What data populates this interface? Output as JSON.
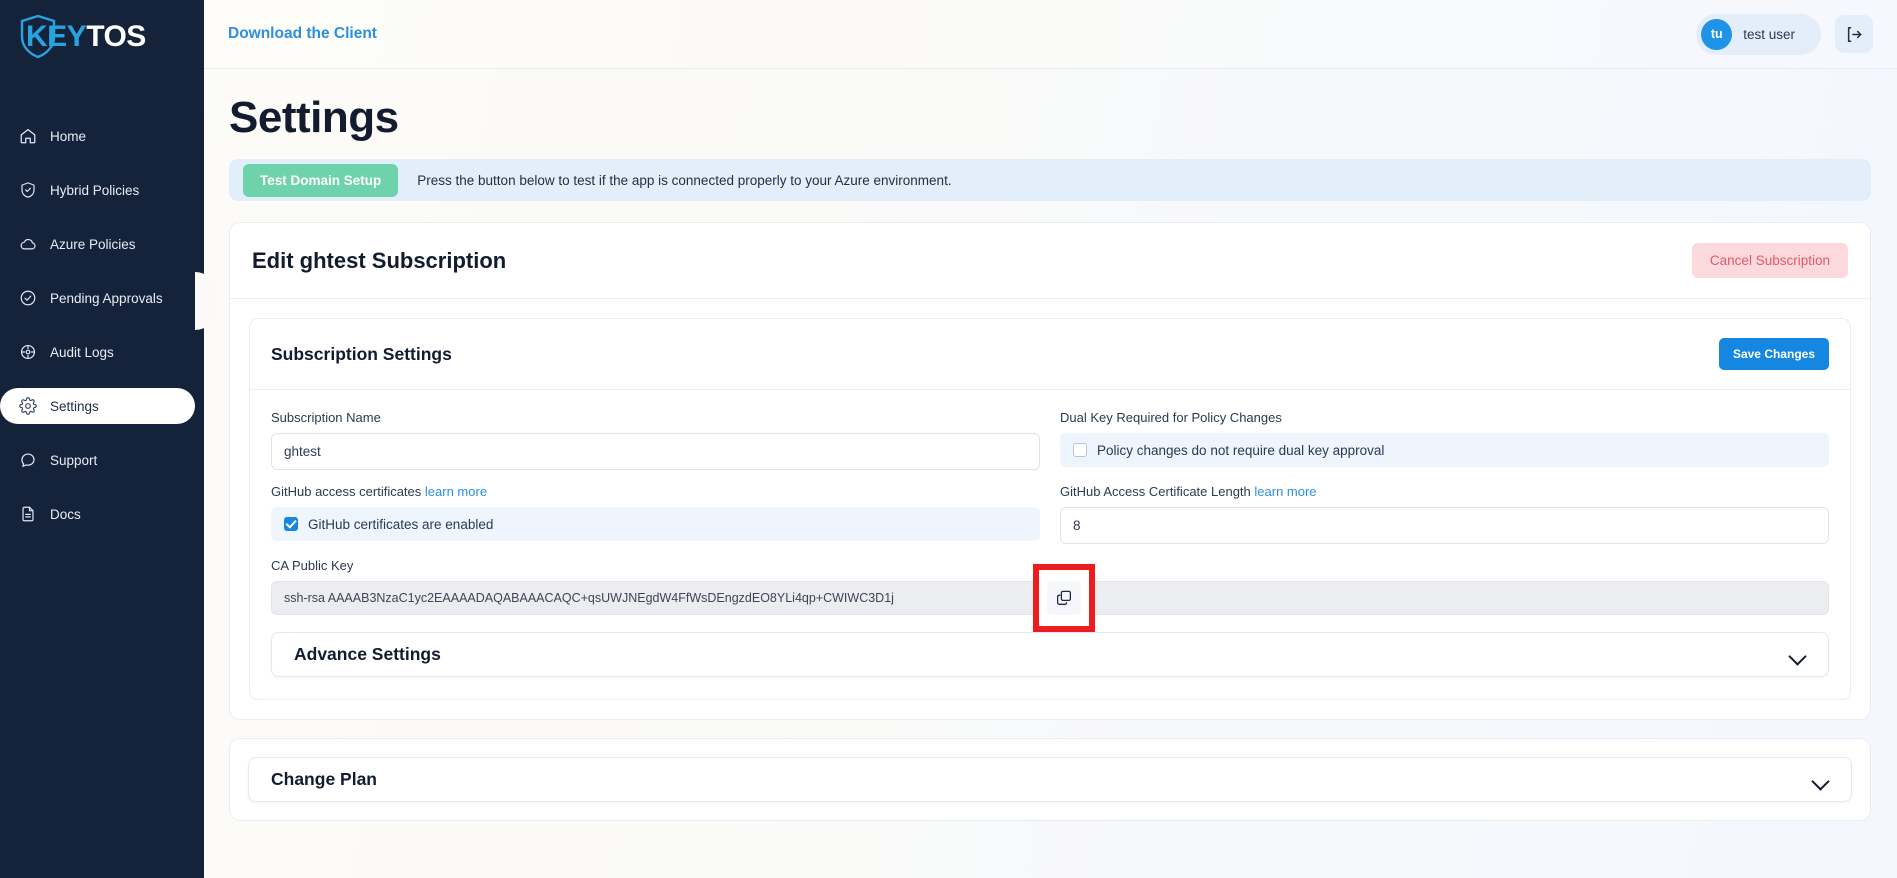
{
  "brand": {
    "logo_key": "KEY",
    "logo_tos": "TOS"
  },
  "sidebar": {
    "items": [
      {
        "label": "Home",
        "icon": "home-icon",
        "active": false
      },
      {
        "label": "Hybrid Policies",
        "icon": "shield-icon",
        "active": false
      },
      {
        "label": "Azure Policies",
        "icon": "cloud-icon",
        "active": false
      },
      {
        "label": "Pending Approvals",
        "icon": "check-circle-icon",
        "active": false
      },
      {
        "label": "Audit Logs",
        "icon": "compass-icon",
        "active": false
      },
      {
        "label": "Settings",
        "icon": "gear-icon",
        "active": true
      },
      {
        "label": "Support",
        "icon": "chat-icon",
        "active": false
      },
      {
        "label": "Docs",
        "icon": "document-icon",
        "active": false
      }
    ]
  },
  "topbar": {
    "download_link": "Download the Client",
    "user": {
      "initials": "tu",
      "name": "test user"
    },
    "logout_icon": "logout-icon"
  },
  "page": {
    "title": "Settings"
  },
  "test_banner": {
    "button_label": "Test Domain Setup",
    "description": "Press the button below to test if the app is connected properly to your Azure environment."
  },
  "subscription_card": {
    "title": "Edit ghtest Subscription",
    "cancel_button": "Cancel Subscription"
  },
  "subscription_settings": {
    "title": "Subscription Settings",
    "save_button": "Save Changes",
    "fields": {
      "subscription_name": {
        "label": "Subscription Name",
        "value": "ghtest"
      },
      "dual_key": {
        "label": "Dual Key Required for Policy Changes",
        "checkbox_label": "Policy changes do not require dual key approval",
        "checked": false
      },
      "github_access_certificates": {
        "label": "GitHub access certificates",
        "learn_more": "learn more",
        "checkbox_label": "GitHub certificates are enabled",
        "checked": true
      },
      "github_cert_length": {
        "label": "GitHub Access Certificate Length",
        "learn_more": "learn more",
        "value": "8"
      },
      "ca_public_key": {
        "label": "CA Public Key",
        "value": "ssh-rsa AAAAB3NzaC1yc2EAAAADAQABAAACAQC+qsUWJNEgdW4FfWsDEngzdEO8YLi4qp+CWIWC3D1j",
        "copy_icon": "copy-icon"
      }
    },
    "advance_settings": {
      "label": "Advance Settings",
      "chevron": "chevron-down-icon"
    }
  },
  "change_plan": {
    "label": "Change Plan",
    "chevron": "chevron-down-icon"
  },
  "colors": {
    "sidebar_bg": "#14223a",
    "brand_blue": "#29a3e0",
    "accent_blue": "#1687e0",
    "green": "#6ed3ab",
    "danger_pink": "#fbd9dc",
    "danger_text": "#e05a6b",
    "highlight_red": "#ee1c1c",
    "banner_blue": "#e2eef9"
  }
}
